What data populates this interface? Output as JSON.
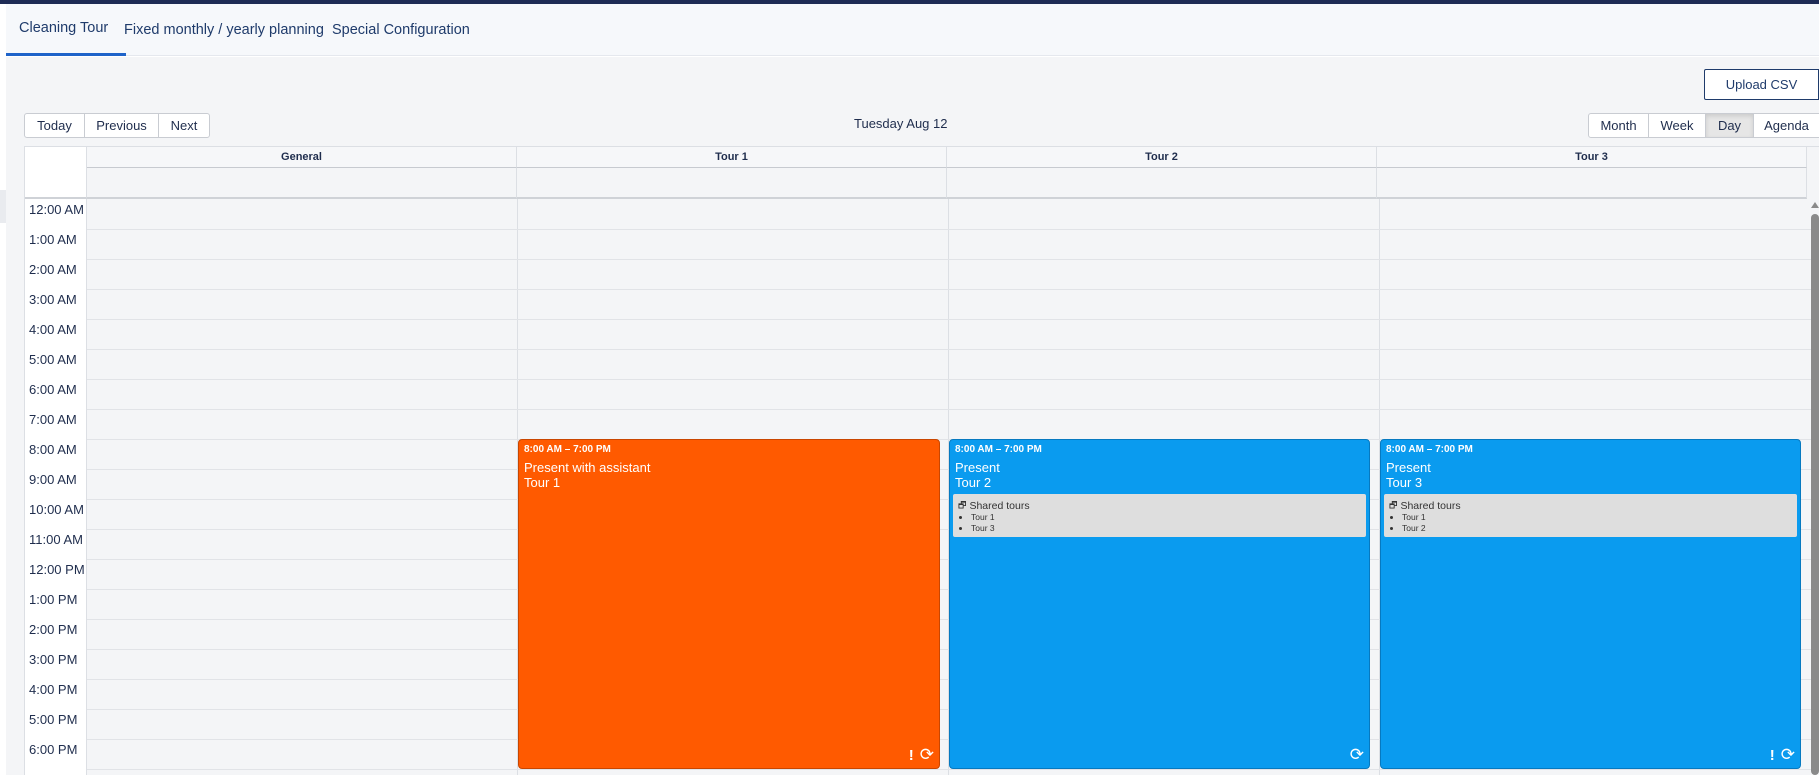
{
  "tabs": [
    {
      "label": "Cleaning Tour",
      "active": true
    },
    {
      "label": "Fixed monthly / yearly planning",
      "active": false
    },
    {
      "label": "Special Configuration",
      "active": false
    }
  ],
  "toolbar": {
    "upload_label": "Upload CSV",
    "nav": [
      "Today",
      "Previous",
      "Next"
    ],
    "date": "Tuesday Aug 12",
    "views": [
      "Month",
      "Week",
      "Day",
      "Agenda"
    ],
    "active_view": "Day"
  },
  "calendar": {
    "columns": [
      "General",
      "Tour 1",
      "Tour 2",
      "Tour 3"
    ],
    "times": [
      "12:00 AM",
      "1:00 AM",
      "2:00 AM",
      "3:00 AM",
      "4:00 AM",
      "5:00 AM",
      "6:00 AM",
      "7:00 AM",
      "8:00 AM",
      "9:00 AM",
      "10:00 AM",
      "11:00 AM",
      "12:00 PM",
      "1:00 PM",
      "2:00 PM",
      "3:00 PM",
      "4:00 PM",
      "5:00 PM",
      "6:00 PM"
    ],
    "events": [
      {
        "column": "Tour 1",
        "time": "8:00 AM – 7:00 PM",
        "title": "Present with assistant",
        "subtitle": "Tour 1",
        "color": "#ff5a00"
      },
      {
        "column": "Tour 2",
        "time": "8:00 AM – 7:00 PM",
        "title": "Present",
        "subtitle": "Tour 2",
        "color": "#0a9bef",
        "shared_title": "Shared tours",
        "shared": [
          "Tour 1",
          "Tour 3"
        ]
      },
      {
        "column": "Tour 3",
        "time": "8:00 AM – 7:00 PM",
        "title": "Present",
        "subtitle": "Tour 3",
        "color": "#0a9bef",
        "shared_title": "Shared tours",
        "shared": [
          "Tour 1",
          "Tour 2"
        ]
      }
    ]
  },
  "colors": {
    "accent": "#1e63c9",
    "navy": "#1e2b55",
    "orange_event": "#ff5a00",
    "blue_event": "#0a9bef"
  },
  "icons": {
    "repeat": "repeat-icon",
    "warning": "exclamation-icon",
    "shared": "shared-tours-icon"
  }
}
